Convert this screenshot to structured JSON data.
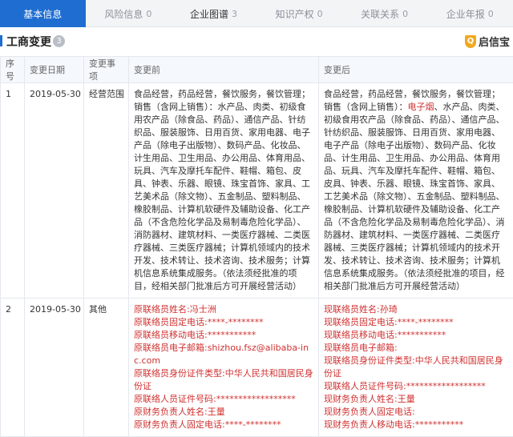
{
  "tabs": [
    {
      "label": "基本信息",
      "count": ""
    },
    {
      "label": "风险信息",
      "count": "0"
    },
    {
      "label": "企业图谱",
      "count": "3"
    },
    {
      "label": "知识产权",
      "count": "0"
    },
    {
      "label": "关联关系",
      "count": "0"
    },
    {
      "label": "企业年报",
      "count": "0"
    }
  ],
  "section": {
    "title": "工商变更",
    "count": "3"
  },
  "brand": {
    "name": "启信宝",
    "icon": "shield-logo-icon"
  },
  "table": {
    "headers": [
      "序号",
      "变更日期",
      "变更事项",
      "变更前",
      "变更后"
    ],
    "rows": [
      {
        "index": "1",
        "date": "2019-05-30",
        "item": "经营范围",
        "before": "食品经营，药品经营，餐饮服务，餐饮管理；销售（含网上销售）：水产品、肉类、初级食用农产品（除食品、药品）、通信产品、针纺织品、服装服饰、日用百货、家用电器、电子产品（除电子出版物）、数码产品、化妆品、计生用品、卫生用品、办公用品、体育用品、玩具、汽车及摩托车配件、鞋帽、箱包、皮具、钟表、乐器、眼镜、珠宝首饰、家具、工艺美术品（除文物）、五金制品、塑料制品、橡胶制品、计算机软硬件及辅助设备、化工产品（不含危险化学品及易制毒危险化学品）、消防器材、建筑材料、一类医疗器械、二类医疗器械、三类医疗器械；计算机领域内的技术开发、技术转让、技术咨询、技术服务；计算机信息系统集成服务。（依法须经批准的项目，经相关部门批准后方可开展经营活动）",
        "after_pre": "食品经营，药品经营，餐饮服务，餐饮管理；销售（含网上销售）：",
        "after_highlight": "电子烟",
        "after_post": "、水产品、肉类、初级食用农产品（除食品、药品）、通信产品、针纺织品、服装服饰、日用百货、家用电器、电子产品（除电子出版物）、数码产品、化妆品、计生用品、卫生用品、办公用品、体育用品、玩具、汽车及摩托车配件、鞋帽、箱包、皮具、钟表、乐器、眼镜、珠宝首饰、家具、工艺美术品（除文物）、五金制品、塑料制品、橡胶制品、计算机软硬件及辅助设备、化工产品（不含危险化学品及易制毒危险化学品）、消防器材、建筑材料、一类医疗器械、二类医疗器械、三类医疗器械；计算机领域内的技术开发、技术转让、技术咨询、技术服务；计算机信息系统集成服务。（依法须经批准的项目，经相关部门批准后方可开展经营活动）"
      },
      {
        "index": "2",
        "date": "2019-05-30",
        "item": "其他",
        "before_lines": [
          "原联络员姓名:冯士洲",
          "原联络员固定电话:****-********",
          "原联络员移动电话:***********",
          "原联络员电子邮箱:shizhou.fsz@alibaba-inc.com",
          "原联络员身份证件类型:中华人民共和国居民身份证",
          "原联络人员证件号码:******************",
          "原财务负责人姓名:王量",
          "原财务负责人固定电话:****-********"
        ],
        "after_lines": [
          "现联络员姓名:孙琦",
          "现联络员固定电话:****-********",
          "现联络员移动电话:***********",
          "现联络员电子邮箱:",
          "现联络员身份证件类型:中华人民共和国居民身份证",
          "现联络人员证件号码:******************",
          "现财务负责人姓名:王量",
          "现财务负责人固定电话:",
          "现财务负责人移动电话:***********"
        ]
      }
    ]
  }
}
